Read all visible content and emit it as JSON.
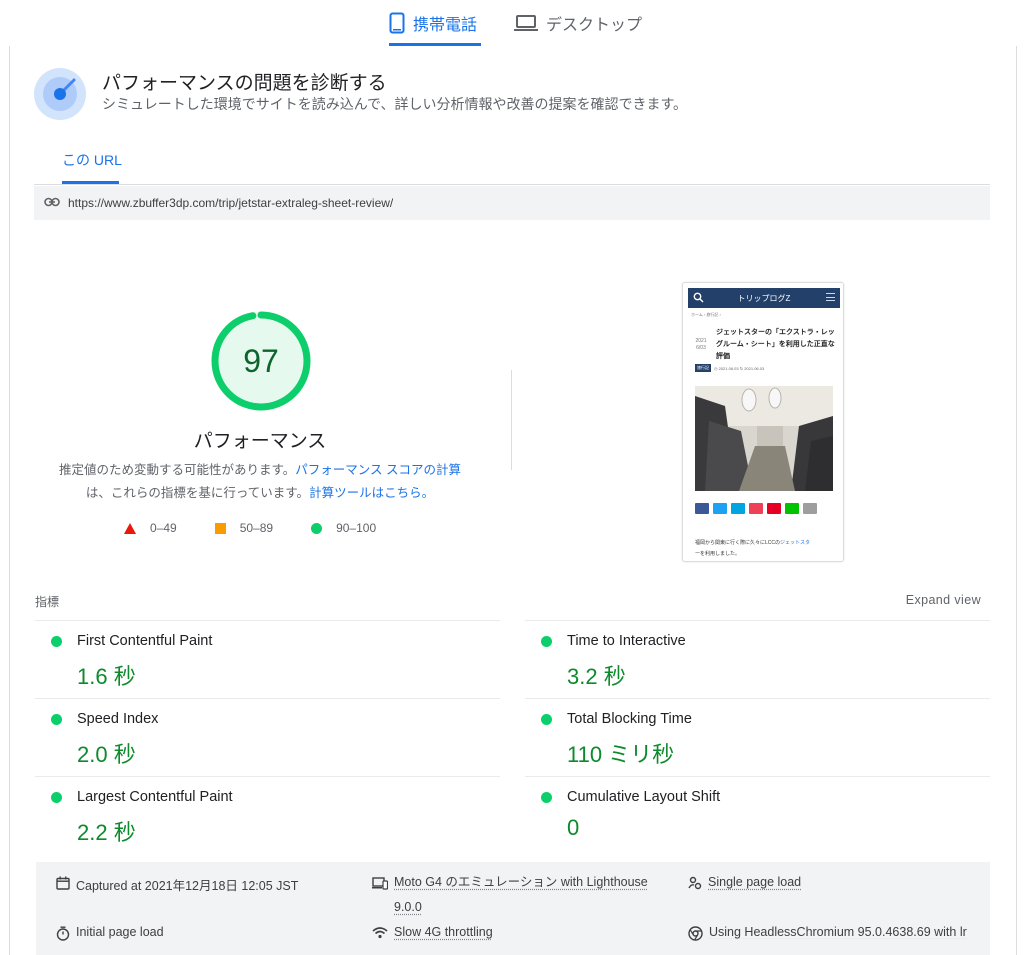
{
  "device_tabs": {
    "mobile": {
      "label": "携帯電話",
      "icon": "mobile-phone-icon",
      "active": true
    },
    "desktop": {
      "label": "デスクトップ",
      "icon": "laptop-icon",
      "active": false
    }
  },
  "diagnose": {
    "title": "パフォーマンスの問題を診断する",
    "subtitle": "シミュレートした環境でサイトを読み込んで、詳しい分析情報や改善の提案を確認できます。",
    "icon": "lighthouse-gauge-icon"
  },
  "url_section": {
    "tab_label": "この URL",
    "url": "https://www.zbuffer3dp.com/trip/jetstar-extraleg-sheet-review/",
    "icon": "link-icon"
  },
  "score": {
    "value": "97",
    "fraction": 0.97,
    "label": "パフォーマンス",
    "note_prefix": "推定値のため変動する可能性があります。",
    "note_link1": "パフォーマンス スコアの計算",
    "note_mid": "は、これらの指標を基に行っています。",
    "note_link2": "計算ツールはこちら。",
    "color": "#0cce6b",
    "text_color": "#0d652d"
  },
  "legend": [
    {
      "shape": "triangle",
      "color": "#e8180c",
      "range": "0–49"
    },
    {
      "shape": "square",
      "color": "#fa9b00",
      "range": "50–89"
    },
    {
      "shape": "circle",
      "color": "#0cce6b",
      "range": "90–100"
    }
  ],
  "screenshot": {
    "site_title": "トリップログZ",
    "breadcrumb": "ホーム › 旅行記 ›",
    "date_line1": "2021",
    "date_line2": "6/03",
    "article_title": "ジェットスターの「エクストラ・レッグルーム・シート」を利用した正直な評価",
    "category": "旅行記",
    "meta_dates": "◷ 2021.06.03  ↻ 2021.06.03",
    "body_text_prefix": "福岡から関東に行く際に久々にLCCの",
    "body_text_link": "ジェットスタ",
    "body_text_suffix": "ーを利用しました。",
    "share_colors": [
      "#3b5998",
      "#1da1f2",
      "#00a4de",
      "#ee4056",
      "#e60023",
      "#00c300",
      "#9e9e9e"
    ]
  },
  "metrics": {
    "heading": "指標",
    "expand_label": "Expand view",
    "items": [
      {
        "label": "First Contentful Paint",
        "value": "1.6 秒",
        "status": "good"
      },
      {
        "label": "Time to Interactive",
        "value": "3.2 秒",
        "status": "good"
      },
      {
        "label": "Speed Index",
        "value": "2.0 秒",
        "status": "good"
      },
      {
        "label": "Total Blocking Time",
        "value": "110 ミリ秒",
        "status": "good"
      },
      {
        "label": "Largest Contentful Paint",
        "value": "2.2 秒",
        "status": "good"
      },
      {
        "label": "Cumulative Layout Shift",
        "value": "0",
        "status": "good"
      }
    ],
    "good_color": "#0cce6b",
    "value_color": "#0d8a2b"
  },
  "run_info": {
    "captured": "Captured at 2021年12月18日 12:05 JST",
    "device_line1": "Moto G4 のエミュレーション with Lighthouse",
    "device_line2": "9.0.0",
    "session": "Single page load",
    "load_type": "Initial page load",
    "throttling": "Slow 4G throttling",
    "browser": "Using HeadlessChromium 95.0.4638.69 with lr"
  }
}
